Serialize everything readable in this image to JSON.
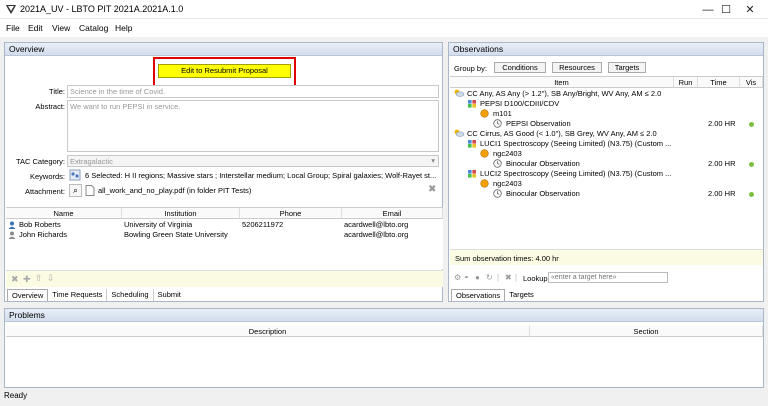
{
  "window": {
    "title": "2021A_UV - LBTO PIT 2021A.2021A.1.0",
    "minimize": "—",
    "maximize": "☐",
    "close": "✕"
  },
  "menu": [
    "File",
    "Edit",
    "View",
    "Catalog",
    "Help"
  ],
  "overview": {
    "header": "Overview",
    "edit_button": "Edit to Resubmit Proposal",
    "title_label": "Title:",
    "title_value": "Science in the time of Covid.",
    "abstract_label": "Abstract:",
    "abstract_value": "We want to run PEPSI in service.",
    "tac_label": "TAC Category:",
    "tac_value": "Extragalactic",
    "keywords_label": "Keywords:",
    "keywords_value": "6 Selected: H II regions; Massive stars ; Interstellar medium; Local Group; Spiral galaxies; Wolf-Rayet st...",
    "attachment_label": "Attachment:",
    "attachment_value": "all_work_and_no_play.pdf (in folder PIT Tests)",
    "investigators": {
      "columns": [
        "Name",
        "Institution",
        "Phone",
        "Email"
      ],
      "rows": [
        {
          "name": "Bob Roberts",
          "institution": "University of Virginia",
          "phone": "5206211972",
          "email": "acardwell@lbto.org"
        },
        {
          "name": "John Richards",
          "institution": "Bowling Green State University",
          "phone": "",
          "email": "acardwell@lbto.org"
        }
      ]
    },
    "tabs": [
      "Overview",
      "Time Requests",
      "Scheduling",
      "Submit"
    ]
  },
  "observations": {
    "header": "Observations",
    "group_by_label": "Group by:",
    "group_buttons": [
      "Conditions",
      "Resources",
      "Targets"
    ],
    "columns": [
      "Item",
      "Run",
      "Time",
      "Vis"
    ],
    "tree": [
      {
        "level": 0,
        "icon": "conditions",
        "text": "CC Any, AS Any (> 1.2\"), SB Any/Bright, WV Any, AM ≤ 2.0",
        "time": "",
        "vis": false
      },
      {
        "level": 1,
        "icon": "resource",
        "text": "PEPSI D100/CDIII/CDV",
        "time": "",
        "vis": false
      },
      {
        "level": 2,
        "icon": "target",
        "text": "m101",
        "time": "",
        "vis": false
      },
      {
        "level": 3,
        "icon": "observation",
        "text": "PEPSI Observation",
        "time": "2.00 HR",
        "vis": true
      },
      {
        "level": 0,
        "icon": "conditions",
        "text": "CC Cirrus, AS Good (< 1.0\"), SB Grey, WV Any, AM ≤ 2.0",
        "time": "",
        "vis": false
      },
      {
        "level": 1,
        "icon": "resource",
        "text": "LUCI1 Spectroscopy (Seeing Limited) (N3.75) (Custom ...",
        "time": "",
        "vis": false
      },
      {
        "level": 2,
        "icon": "target",
        "text": "ngc2403",
        "time": "",
        "vis": false
      },
      {
        "level": 3,
        "icon": "observation",
        "text": "Binocular Observation",
        "time": "2.00 HR",
        "vis": true
      },
      {
        "level": 1,
        "icon": "resource",
        "text": "LUCI2 Spectroscopy (Seeing Limited) (N3.75) (Custom ...",
        "time": "",
        "vis": false
      },
      {
        "level": 2,
        "icon": "target",
        "text": "ngc2403",
        "time": "",
        "vis": false
      },
      {
        "level": 3,
        "icon": "observation",
        "text": "Binocular Observation",
        "time": "2.00 HR",
        "vis": true
      }
    ],
    "sum_text": "Sum observation times: 4.00 hr",
    "lookup_label": "Lookup",
    "lookup_placeholder": "«enter a target here»",
    "tabs": [
      "Observations",
      "Targets"
    ]
  },
  "problems": {
    "header": "Problems",
    "columns": [
      "Description",
      "Section"
    ]
  },
  "status": "Ready",
  "colors": {
    "accent": "#ffff00",
    "highlight_box": "#e00000",
    "vis_dot": "#7ac143"
  }
}
